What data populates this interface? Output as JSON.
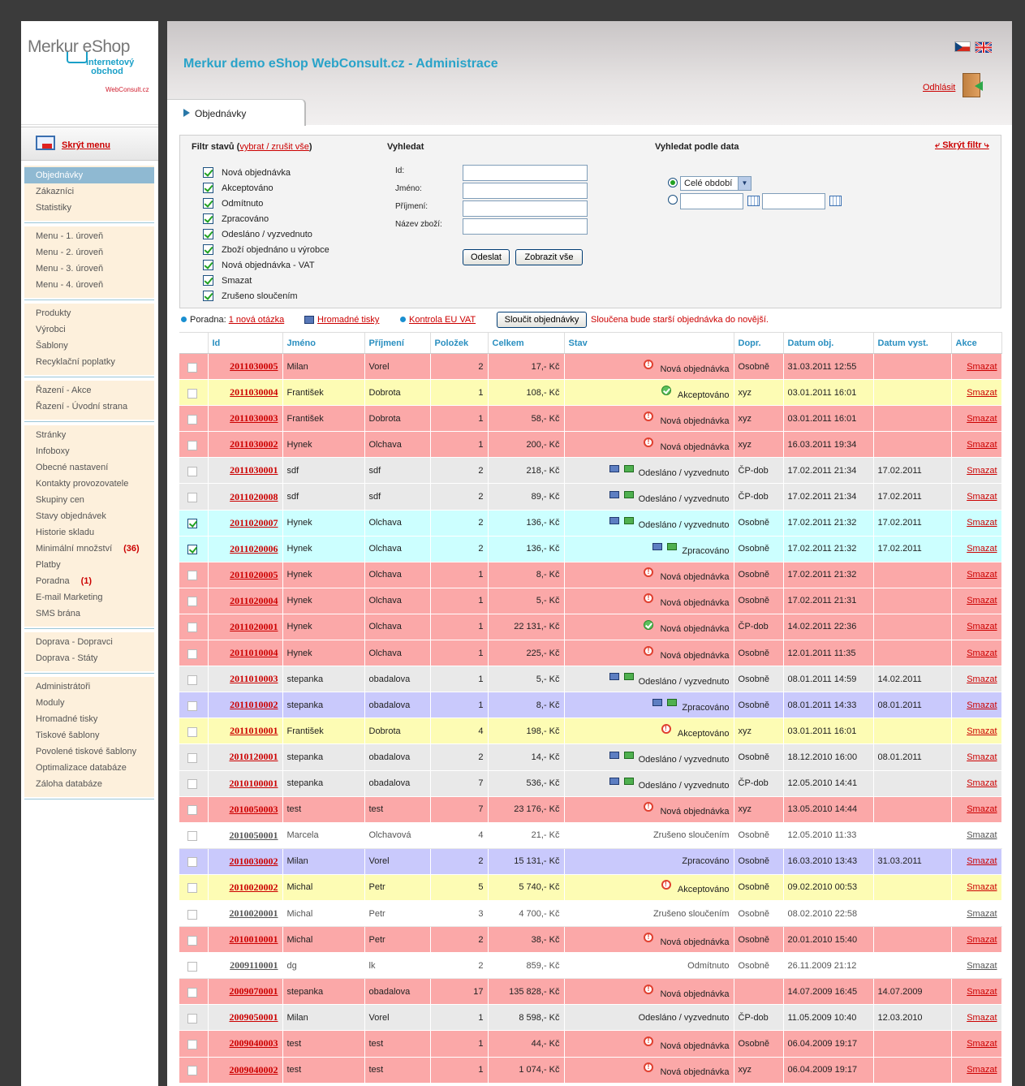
{
  "header": {
    "title": "Merkur demo eShop WebConsult.cz - Administrace",
    "logout_label": "Odhlásit",
    "tab_label": "Objednávky"
  },
  "logo": {
    "main": "Merkur eShop",
    "sub_line1": "internetový",
    "sub_line2": "obchod",
    "brand": "WebConsult.cz"
  },
  "sidebar": {
    "hide_menu_label": "Skrýt menu",
    "groups": [
      [
        {
          "label": "Objednávky",
          "active": true
        },
        {
          "label": "Zákazníci"
        },
        {
          "label": "Statistiky"
        }
      ],
      [
        {
          "label": "Menu - 1. úroveň"
        },
        {
          "label": "Menu - 2. úroveň"
        },
        {
          "label": "Menu - 3. úroveň"
        },
        {
          "label": "Menu - 4. úroveň"
        }
      ],
      [
        {
          "label": "Produkty"
        },
        {
          "label": "Výrobci"
        },
        {
          "label": "Šablony"
        },
        {
          "label": "Recyklační poplatky"
        }
      ],
      [
        {
          "label": "Řazení - Akce"
        },
        {
          "label": "Řazení - Úvodní strana"
        }
      ],
      [
        {
          "label": "Stránky"
        },
        {
          "label": "Infoboxy"
        },
        {
          "label": "Obecné nastavení"
        },
        {
          "label": "Kontakty provozovatele"
        },
        {
          "label": "Skupiny cen"
        },
        {
          "label": "Stavy objednávek"
        },
        {
          "label": "Historie skladu"
        },
        {
          "label": "Minimální množství",
          "count": "(36)"
        },
        {
          "label": "Platby"
        },
        {
          "label": "Poradna",
          "count": "(1)"
        },
        {
          "label": "E-mail Marketing"
        },
        {
          "label": "SMS brána"
        }
      ],
      [
        {
          "label": "Doprava - Dopravci"
        },
        {
          "label": "Doprava - Státy"
        }
      ],
      [
        {
          "label": "Administrátoři"
        },
        {
          "label": "Moduly"
        },
        {
          "label": "Hromadné tisky"
        },
        {
          "label": "Tiskové šablony"
        },
        {
          "label": "Povolené tiskové šablony"
        },
        {
          "label": "Optimalizace databáze"
        },
        {
          "label": "Záloha databáze"
        }
      ]
    ]
  },
  "filter": {
    "states_heading": "Filtr stavů",
    "select_all_link": "vybrat / zrušit vše",
    "states": [
      "Nová objednávka",
      "Akceptováno",
      "Odmítnuto",
      "Zpracováno",
      "Odesláno / vyzvednuto",
      "Zboží objednáno u výrobce",
      "Nová objednávka - VAT",
      "Smazat",
      "Zrušeno sloučením"
    ],
    "search_heading": "Vyhledat",
    "search_fields": [
      "Id:",
      "Jméno:",
      "Příjmení:",
      "Název zboží:"
    ],
    "submit_label": "Odeslat",
    "show_all_label": "Zobrazit vše",
    "date_heading": "Vyhledat podle data",
    "period_option": "Celé období",
    "hide_filter_label": "Skrýt filtr"
  },
  "toolbar": {
    "poradna_label": "Poradna:",
    "poradna_link": "1 nová otázka",
    "bulk_print_link": "Hromadné tisky",
    "vat_link": "Kontrola EU VAT",
    "merge_button": "Sloučit objednávky",
    "merge_note": "Sloučena bude starší objednávka do novější."
  },
  "columns": [
    "Id",
    "Jméno",
    "Příjmení",
    "Položek",
    "Celkem",
    "Stav",
    "Dopr.",
    "Datum obj.",
    "Datum vyst.",
    "Akce"
  ],
  "orders": [
    {
      "color": "red",
      "checked": false,
      "id": "2011030005",
      "jmeno": "Milan",
      "prijmeni": "Vorel",
      "polozek": "2",
      "celkem": "17,- Kč",
      "icon": "alert",
      "stav": "Nová objednávka",
      "dopr": "Osobně",
      "datum_obj": "31.03.2011 12:55",
      "datum_vyst": "",
      "akce": "Smazat"
    },
    {
      "color": "yellow",
      "checked": false,
      "id": "2011030004",
      "jmeno": "František",
      "prijmeni": "Dobrota",
      "polozek": "1",
      "celkem": "108,- Kč",
      "icon": "ok",
      "stav": "Akceptováno",
      "dopr": "xyz",
      "datum_obj": "03.01.2011 16:01",
      "datum_vyst": "",
      "akce": "Smazat"
    },
    {
      "color": "red",
      "checked": false,
      "id": "2011030003",
      "jmeno": "František",
      "prijmeni": "Dobrota",
      "polozek": "1",
      "celkem": "58,- Kč",
      "icon": "alert",
      "stav": "Nová objednávka",
      "dopr": "xyz",
      "datum_obj": "03.01.2011 16:01",
      "datum_vyst": "",
      "akce": "Smazat"
    },
    {
      "color": "red",
      "checked": false,
      "id": "2011030002",
      "jmeno": "Hynek",
      "prijmeni": "Olchava",
      "polozek": "1",
      "celkem": "200,- Kč",
      "icon": "alert",
      "stav": "Nová objednávka",
      "dopr": "xyz",
      "datum_obj": "16.03.2011 19:34",
      "datum_vyst": "",
      "akce": "Smazat"
    },
    {
      "color": "gray",
      "checked": false,
      "id": "2011030001",
      "jmeno": "sdf",
      "prijmeni": "sdf",
      "polozek": "2",
      "celkem": "218,- Kč",
      "icon": "print",
      "stav": "Odesláno / vyzvednuto",
      "dopr": "ČP-dob",
      "datum_obj": "17.02.2011 21:34",
      "datum_vyst": "17.02.2011",
      "akce": "Smazat"
    },
    {
      "color": "gray",
      "checked": false,
      "id": "2011020008",
      "jmeno": "sdf",
      "prijmeni": "sdf",
      "polozek": "2",
      "celkem": "89,- Kč",
      "icon": "print",
      "stav": "Odesláno / vyzvednuto",
      "dopr": "ČP-dob",
      "datum_obj": "17.02.2011 21:34",
      "datum_vyst": "17.02.2011",
      "akce": "Smazat"
    },
    {
      "color": "cyan",
      "checked": true,
      "id": "2011020007",
      "jmeno": "Hynek",
      "prijmeni": "Olchava",
      "polozek": "2",
      "celkem": "136,- Kč",
      "icon": "print",
      "stav": "Odesláno / vyzvednuto",
      "dopr": "Osobně",
      "datum_obj": "17.02.2011 21:32",
      "datum_vyst": "17.02.2011",
      "akce": "Smazat"
    },
    {
      "color": "cyan",
      "checked": true,
      "id": "2011020006",
      "jmeno": "Hynek",
      "prijmeni": "Olchava",
      "polozek": "2",
      "celkem": "136,- Kč",
      "icon": "print",
      "stav": "Zpracováno",
      "dopr": "Osobně",
      "datum_obj": "17.02.2011 21:32",
      "datum_vyst": "17.02.2011",
      "akce": "Smazat"
    },
    {
      "color": "red",
      "checked": false,
      "id": "2011020005",
      "jmeno": "Hynek",
      "prijmeni": "Olchava",
      "polozek": "1",
      "celkem": "8,- Kč",
      "icon": "alert",
      "stav": "Nová objednávka",
      "dopr": "Osobně",
      "datum_obj": "17.02.2011 21:32",
      "datum_vyst": "",
      "akce": "Smazat"
    },
    {
      "color": "red",
      "checked": false,
      "id": "2011020004",
      "jmeno": "Hynek",
      "prijmeni": "Olchava",
      "polozek": "1",
      "celkem": "5,- Kč",
      "icon": "alert",
      "stav": "Nová objednávka",
      "dopr": "Osobně",
      "datum_obj": "17.02.2011 21:31",
      "datum_vyst": "",
      "akce": "Smazat"
    },
    {
      "color": "red",
      "checked": false,
      "id": "2011020001",
      "jmeno": "Hynek",
      "prijmeni": "Olchava",
      "polozek": "1",
      "celkem": "22 131,- Kč",
      "icon": "ok",
      "stav": "Nová objednávka",
      "dopr": "ČP-dob",
      "datum_obj": "14.02.2011 22:36",
      "datum_vyst": "",
      "akce": "Smazat"
    },
    {
      "color": "red",
      "checked": false,
      "id": "2011010004",
      "jmeno": "Hynek",
      "prijmeni": "Olchava",
      "polozek": "1",
      "celkem": "225,- Kč",
      "icon": "alert",
      "stav": "Nová objednávka",
      "dopr": "Osobně",
      "datum_obj": "12.01.2011 11:35",
      "datum_vyst": "",
      "akce": "Smazat"
    },
    {
      "color": "gray",
      "checked": false,
      "id": "2011010003",
      "jmeno": "stepanka",
      "prijmeni": "obadalova",
      "polozek": "1",
      "celkem": "5,- Kč",
      "icon": "print",
      "stav": "Odesláno / vyzvednuto",
      "dopr": "Osobně",
      "datum_obj": "08.01.2011 14:59",
      "datum_vyst": "14.02.2011",
      "akce": "Smazat"
    },
    {
      "color": "purple",
      "checked": false,
      "id": "2011010002",
      "jmeno": "stepanka",
      "prijmeni": "obadalova",
      "polozek": "1",
      "celkem": "8,- Kč",
      "icon": "print",
      "stav": "Zpracováno",
      "dopr": "Osobně",
      "datum_obj": "08.01.2011 14:33",
      "datum_vyst": "08.01.2011",
      "akce": "Smazat"
    },
    {
      "color": "yellow",
      "checked": false,
      "id": "2011010001",
      "jmeno": "František",
      "prijmeni": "Dobrota",
      "polozek": "4",
      "celkem": "198,- Kč",
      "icon": "alert",
      "stav": "Akceptováno",
      "dopr": "xyz",
      "datum_obj": "03.01.2011 16:01",
      "datum_vyst": "",
      "akce": "Smazat"
    },
    {
      "color": "gray",
      "checked": false,
      "id": "2010120001",
      "jmeno": "stepanka",
      "prijmeni": "obadalova",
      "polozek": "2",
      "celkem": "14,- Kč",
      "icon": "print",
      "stav": "Odesláno / vyzvednuto",
      "dopr": "Osobně",
      "datum_obj": "18.12.2010 16:00",
      "datum_vyst": "08.01.2011",
      "akce": "Smazat"
    },
    {
      "color": "gray",
      "checked": false,
      "id": "2010100001",
      "jmeno": "stepanka",
      "prijmeni": "obadalova",
      "polozek": "7",
      "celkem": "536,- Kč",
      "icon": "print",
      "stav": "Odesláno / vyzvednuto",
      "dopr": "ČP-dob",
      "datum_obj": "12.05.2010 14:41",
      "datum_vyst": "",
      "akce": "Smazat"
    },
    {
      "color": "red",
      "checked": false,
      "id": "2010050003",
      "jmeno": "test",
      "prijmeni": "test",
      "polozek": "7",
      "celkem": "23 176,- Kč",
      "icon": "alert",
      "stav": "Nová objednávka",
      "dopr": "xyz",
      "datum_obj": "13.05.2010 14:44",
      "datum_vyst": "",
      "akce": "Smazat"
    },
    {
      "color": "white",
      "checked": false,
      "id": "2010050001",
      "jmeno": "Marcela",
      "prijmeni": "Olchavová",
      "polozek": "4",
      "celkem": "21,- Kč",
      "icon": "",
      "stav": "Zrušeno sloučením",
      "dopr": "Osobně",
      "datum_obj": "12.05.2010 11:33",
      "datum_vyst": "",
      "akce": "Smazat"
    },
    {
      "color": "purple",
      "checked": false,
      "id": "2010030002",
      "jmeno": "Milan",
      "prijmeni": "Vorel",
      "polozek": "2",
      "celkem": "15 131,- Kč",
      "icon": "",
      "stav": "Zpracováno",
      "dopr": "Osobně",
      "datum_obj": "16.03.2010 13:43",
      "datum_vyst": "31.03.2011",
      "akce": "Smazat"
    },
    {
      "color": "yellow",
      "checked": false,
      "id": "2010020002",
      "jmeno": "Michal",
      "prijmeni": "Petr",
      "polozek": "5",
      "celkem": "5 740,- Kč",
      "icon": "alert",
      "stav": "Akceptováno",
      "dopr": "Osobně",
      "datum_obj": "09.02.2010 00:53",
      "datum_vyst": "",
      "akce": "Smazat"
    },
    {
      "color": "white",
      "checked": false,
      "id": "2010020001",
      "jmeno": "Michal",
      "prijmeni": "Petr",
      "polozek": "3",
      "celkem": "4 700,- Kč",
      "icon": "",
      "stav": "Zrušeno sloučením",
      "dopr": "Osobně",
      "datum_obj": "08.02.2010 22:58",
      "datum_vyst": "",
      "akce": "Smazat"
    },
    {
      "color": "red",
      "checked": false,
      "id": "2010010001",
      "jmeno": "Michal",
      "prijmeni": "Petr",
      "polozek": "2",
      "celkem": "38,- Kč",
      "icon": "alert",
      "stav": "Nová objednávka",
      "dopr": "Osobně",
      "datum_obj": "20.01.2010 15:40",
      "datum_vyst": "",
      "akce": "Smazat"
    },
    {
      "color": "white",
      "checked": false,
      "id": "2009110001",
      "jmeno": "dg",
      "prijmeni": "lk",
      "polozek": "2",
      "celkem": "859,- Kč",
      "icon": "",
      "stav": "Odmítnuto",
      "dopr": "Osobně",
      "datum_obj": "26.11.2009 21:12",
      "datum_vyst": "",
      "akce": "Smazat"
    },
    {
      "color": "red",
      "checked": false,
      "id": "2009070001",
      "jmeno": "stepanka",
      "prijmeni": "obadalova",
      "polozek": "17",
      "celkem": "135 828,- Kč",
      "icon": "alert",
      "stav": "Nová objednávka",
      "dopr": "",
      "datum_obj": "14.07.2009 16:45",
      "datum_vyst": "14.07.2009",
      "akce": "Smazat"
    },
    {
      "color": "gray",
      "checked": false,
      "id": "2009050001",
      "jmeno": "Milan",
      "prijmeni": "Vorel",
      "polozek": "1",
      "celkem": "8 598,- Kč",
      "icon": "",
      "stav": "Odesláno / vyzvednuto",
      "dopr": "ČP-dob",
      "datum_obj": "11.05.2009 10:40",
      "datum_vyst": "12.03.2010",
      "akce": "Smazat"
    },
    {
      "color": "red",
      "checked": false,
      "id": "2009040003",
      "jmeno": "test",
      "prijmeni": "test",
      "polozek": "1",
      "celkem": "44,- Kč",
      "icon": "alert",
      "stav": "Nová objednávka",
      "dopr": "Osobně",
      "datum_obj": "06.04.2009 19:17",
      "datum_vyst": "",
      "akce": "Smazat"
    },
    {
      "color": "red",
      "checked": false,
      "id": "2009040002",
      "jmeno": "test",
      "prijmeni": "test",
      "polozek": "1",
      "celkem": "1 074,- Kč",
      "icon": "alert",
      "stav": "Nová objednávka",
      "dopr": "xyz",
      "datum_obj": "06.04.2009 19:17",
      "datum_vyst": "",
      "akce": "Smazat"
    }
  ]
}
